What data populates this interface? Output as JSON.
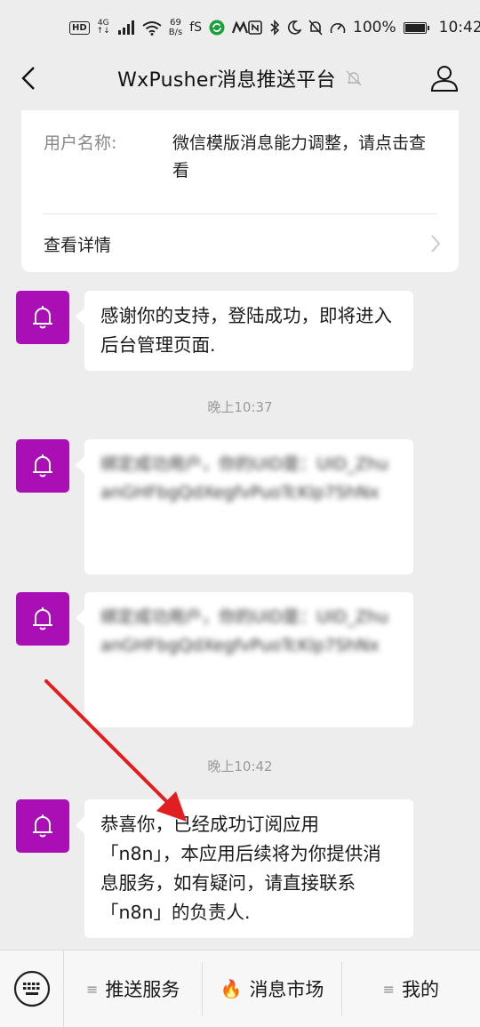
{
  "status_bar": {
    "hd": "HD",
    "net_type": "4G",
    "net_sub": "↑↓",
    "speed_value": "69",
    "speed_unit": "B/s",
    "app_label": "fS",
    "battery": "100%",
    "time": "10:42"
  },
  "header": {
    "title": "WxPusher消息推送平台"
  },
  "notice_card": {
    "label": "用户名称:",
    "value": "微信模版消息能力调整，请点击查看",
    "link_text": "查看详情"
  },
  "messages": [
    {
      "text": "感谢你的支持，登陆成功，即将进入后台管理页面."
    },
    {
      "time": "晚上10:37"
    },
    {
      "text": "绑定成功用户，你的UID是：UID_ZhuanGHFbgQdXegfvPuoTcKlp7ShNx"
    },
    {
      "text": "绑定成功用户，你的UID是：UID_ZhuanGHFbgQdXegfvPuoTcKlp7ShNx"
    },
    {
      "time": "晚上10:42"
    },
    {
      "text": "恭喜你，已经成功订阅应用「n8n」，本应用后续将为你提供消息服务，如有疑问，请直接联系「n8n」的负责人."
    }
  ],
  "bottom_nav": {
    "items": [
      {
        "label": "推送服务",
        "prefix": "≡"
      },
      {
        "label": "消息市场",
        "prefix": "🔥"
      },
      {
        "label": "我的",
        "prefix": "≡"
      }
    ]
  },
  "colors": {
    "avatar": "#a90fb5",
    "arrow": "#e02020",
    "background": "#ededed"
  }
}
